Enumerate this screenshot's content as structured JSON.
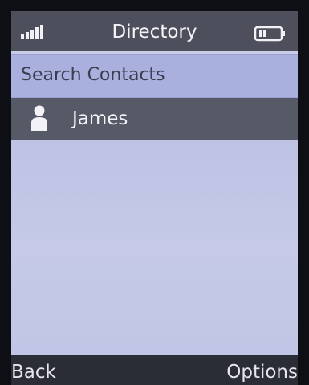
{
  "status_bar": {
    "title": "Directory",
    "signal_icon": "signal-strength-icon",
    "battery_icon": "battery-icon"
  },
  "search": {
    "label": "Search Contacts"
  },
  "contacts": [
    {
      "name": "James",
      "icon": "person-icon"
    }
  ],
  "softkeys": {
    "left": "Back",
    "right": "Options"
  },
  "colors": {
    "status_bar": "#4d505c",
    "search_row": "#aab0dd",
    "selected_row": "#565a67",
    "screen_background": "#c8cce6",
    "text_light": "#f3f3f7"
  }
}
